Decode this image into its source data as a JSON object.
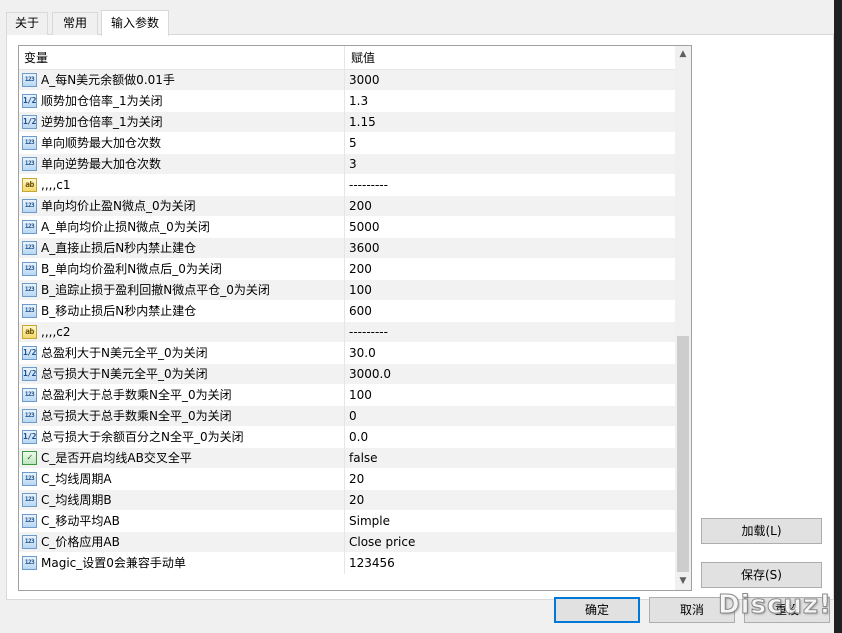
{
  "tabs": [
    {
      "label": "关于"
    },
    {
      "label": "常用"
    },
    {
      "label": "输入参数",
      "active": true
    }
  ],
  "grid": {
    "columns": {
      "variable": "变量",
      "value": "赋值"
    },
    "rows": [
      {
        "icon": "int",
        "name": "A_每N美元余额做0.01手",
        "value": "3000"
      },
      {
        "icon": "double",
        "name": "顺势加仓倍率_1为关闭",
        "value": "1.3"
      },
      {
        "icon": "double",
        "name": "逆势加仓倍率_1为关闭",
        "value": "1.15"
      },
      {
        "icon": "int",
        "name": "单向顺势最大加仓次数",
        "value": "5"
      },
      {
        "icon": "int",
        "name": "单向逆势最大加仓次数",
        "value": "3"
      },
      {
        "icon": "string",
        "name": ",,,,c1",
        "value": "---------"
      },
      {
        "icon": "int",
        "name": "单向均价止盈N微点_0为关闭",
        "value": "200"
      },
      {
        "icon": "int",
        "name": "A_单向均价止损N微点_0为关闭",
        "value": "5000"
      },
      {
        "icon": "int",
        "name": "A_直接止损后N秒内禁止建仓",
        "value": "3600"
      },
      {
        "icon": "int",
        "name": "B_单向均价盈利N微点后_0为关闭",
        "value": "200"
      },
      {
        "icon": "int",
        "name": "B_追踪止损于盈利回撤N微点平仓_0为关闭",
        "value": "100"
      },
      {
        "icon": "int",
        "name": "B_移动止损后N秒内禁止建仓",
        "value": "600"
      },
      {
        "icon": "string",
        "name": ",,,,c2",
        "value": "---------"
      },
      {
        "icon": "double",
        "name": "总盈利大于N美元全平_0为关闭",
        "value": "30.0"
      },
      {
        "icon": "double",
        "name": "总亏损大于N美元全平_0为关闭",
        "value": "3000.0"
      },
      {
        "icon": "int",
        "name": "总盈利大于总手数乘N全平_0为关闭",
        "value": "100"
      },
      {
        "icon": "int",
        "name": "总亏损大于总手数乘N全平_0为关闭",
        "value": "0"
      },
      {
        "icon": "double",
        "name": "总亏损大于余额百分之N全平_0为关闭",
        "value": "0.0"
      },
      {
        "icon": "bool",
        "name": "C_是否开启均线AB交叉全平",
        "value": "false"
      },
      {
        "icon": "int",
        "name": "C_均线周期A",
        "value": "20"
      },
      {
        "icon": "int",
        "name": "C_均线周期B",
        "value": "20"
      },
      {
        "icon": "int",
        "name": "C_移动平均AB",
        "value": "Simple"
      },
      {
        "icon": "int",
        "name": "C_价格应用AB",
        "value": "Close price"
      },
      {
        "icon": "int",
        "name": "Magic_设置0会兼容手动单",
        "value": "123456"
      }
    ]
  },
  "icon_glyphs": {
    "int": "123",
    "double": "1/2",
    "string": "ab",
    "bool": "✓"
  },
  "buttons": {
    "load": "加载(L)",
    "save": "保存(S)",
    "ok": "确定",
    "cancel": "取消",
    "reset": "重设"
  },
  "watermark": "Discuz!"
}
